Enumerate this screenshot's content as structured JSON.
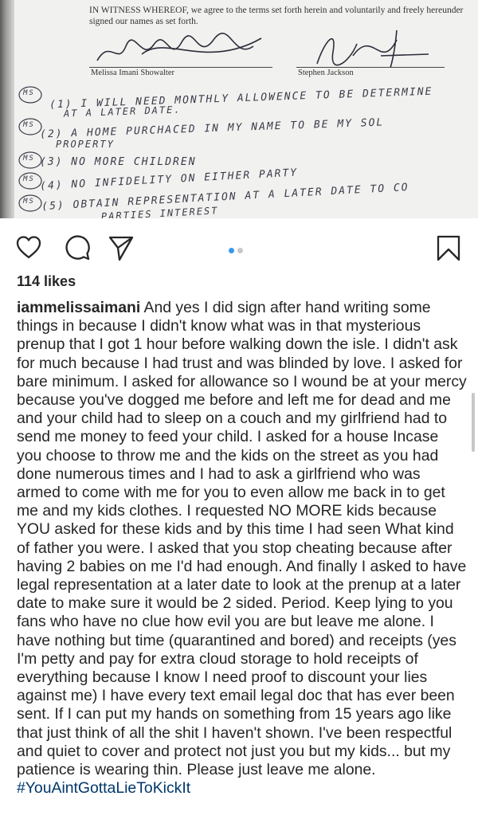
{
  "post_image": {
    "document_text": "IN WITNESS WHEREOF, we agree to the terms set forth herein and voluntarily and freely hereunder signed our names as set forth.",
    "signatory_left": "Melissa Imani Showalter",
    "signatory_right": "Stephen Jackson",
    "handwritten_terms": [
      "(1) I WILL NEED MONTHLY ALLOWENCE TO BE DETERMINE",
      "AT A LATER DATE.",
      "(2) A HOME PURCHACED IN MY NAME TO BE MY SOL",
      "PROPERTY",
      "(3) NO MORE CHILDREN",
      "(4) NO INFIDELITY ON EITHER PARTY",
      "(5) OBTAIN REPRESENTATION AT A LATER DATE TO CO",
      "... PARTIES INTEREST"
    ],
    "initials": [
      "MS",
      "MS",
      "MS",
      "MS",
      "MS"
    ]
  },
  "actions": {
    "like_icon": "heart-icon",
    "comment_icon": "comment-icon",
    "share_icon": "paper-plane-icon",
    "save_icon": "bookmark-icon"
  },
  "carousel": {
    "count": 2,
    "active_index": 0,
    "active_color": "#3897f0",
    "inactive_color": "#c7c7c7"
  },
  "likes": "114 likes",
  "caption": {
    "username": "iammelissaimani",
    "text": "And yes I did sign after hand writing some things in because I didn't know what was in that mysterious prenup that I got 1 hour before walking down the isle. I didn't ask for much because I had trust and was blinded by love. I asked for bare minimum. I asked for allowance so I wound be at your mercy because you've dogged me before and left me for dead and me and your child had to sleep on a couch and my girlfriend had to send me money to feed your child. I asked for a house Incase you choose to throw me and the kids on the street as you had done numerous times and I had to ask a girlfriend who was armed to come with me for you to even allow me back in to get me and my kids clothes. I requested NO MORE kids because YOU asked for these kids and by this time I had seen What kind of father you were. I asked that you stop cheating because after having 2 babies on me I'd had enough. And finally I asked to have legal representation at a later date to look at the prenup at a later date to make sure it would be 2 sided. Period. Keep lying to you fans who have no clue how evil you are but leave me alone. I have nothing but time (quarantined and bored) and receipts (yes I'm petty and pay for extra cloud storage to hold receipts of everything because I know I need proof to discount your lies against me) I have every text email legal doc that has ever been sent. If I can put my hands on something from 15 years ago like that just think of all the shit I haven't shown. I've been respectful and quiet to cover and protect not just you but my kids... but my patience is wearing thin. Please just leave me alone.",
    "hashtag": "#YouAintGottaLieToKickIt"
  }
}
